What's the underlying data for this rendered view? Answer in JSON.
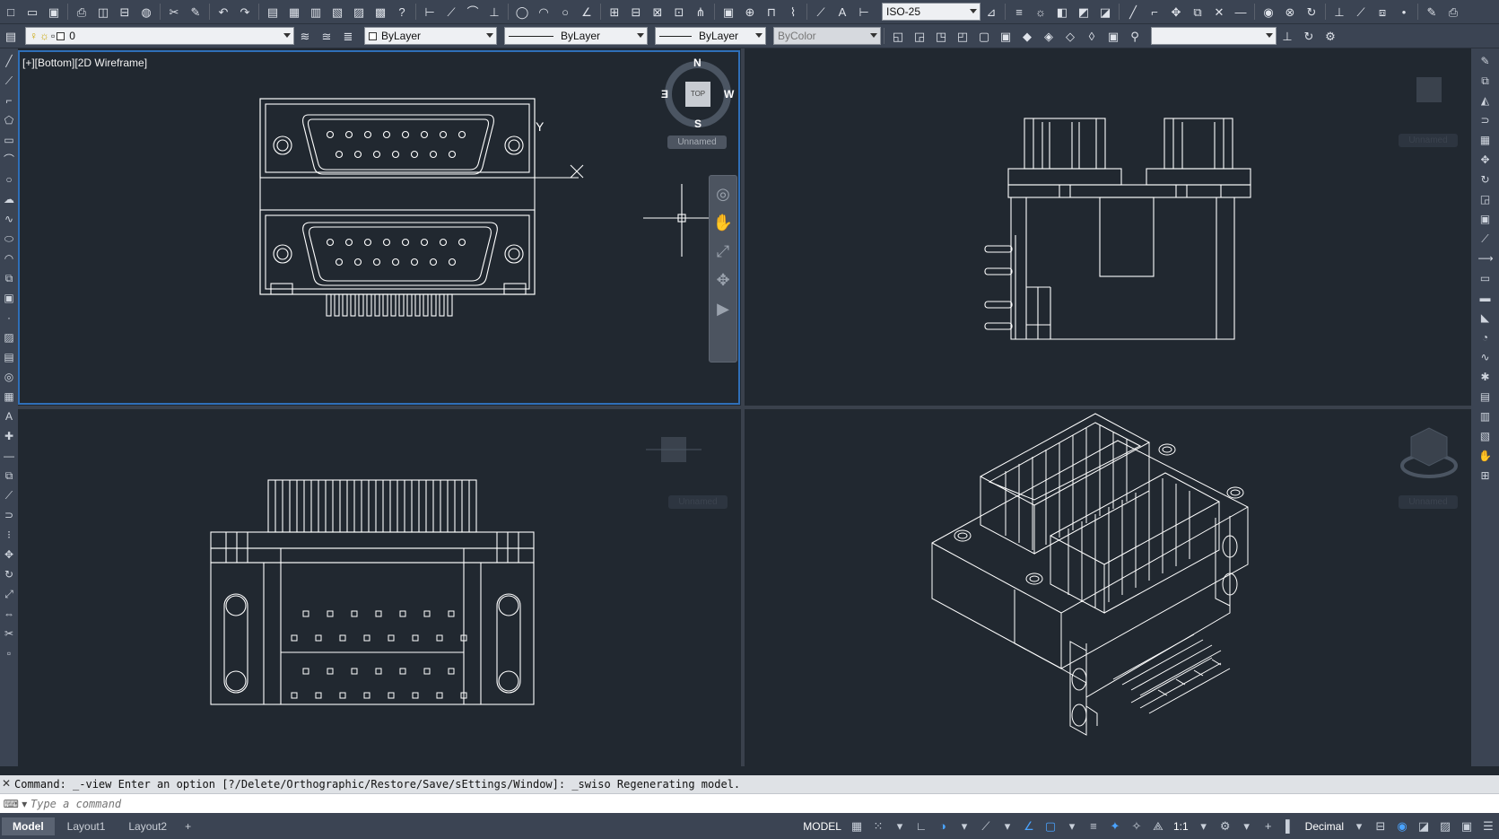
{
  "toolbar1": {
    "dimstyle": "ISO-25"
  },
  "toolbar2": {
    "layer": "0",
    "color": "ByLayer",
    "linetype": "ByLayer",
    "lineweight": "ByLayer",
    "plotstyle": "ByColor",
    "search_value": ""
  },
  "viewports": {
    "top_left_label": "[+][Bottom][2D Wireframe]",
    "viewcube": {
      "north": "N",
      "south": "S",
      "east": "E",
      "west": "W",
      "face": "TOP",
      "ucs": "Unnamed"
    },
    "ucs_tr": "Unnamed",
    "ucs_bl": "Unnamed",
    "ucs_br": "Unnamed"
  },
  "command": {
    "history": "Command: _-view Enter an option [?/Delete/Orthographic/Restore/Save/sEttings/Window]: _swiso Regenerating model.",
    "placeholder": "Type a command"
  },
  "status": {
    "tabs": [
      "Model",
      "Layout1",
      "Layout2"
    ],
    "add_tab": "+",
    "model": "MODEL",
    "scale": "1:1",
    "units": "Decimal"
  },
  "colors": {
    "background": "#212830",
    "toolbar": "#3b4453",
    "active_border": "#2f6fb8",
    "accent_blue": "#4aa3ff"
  }
}
